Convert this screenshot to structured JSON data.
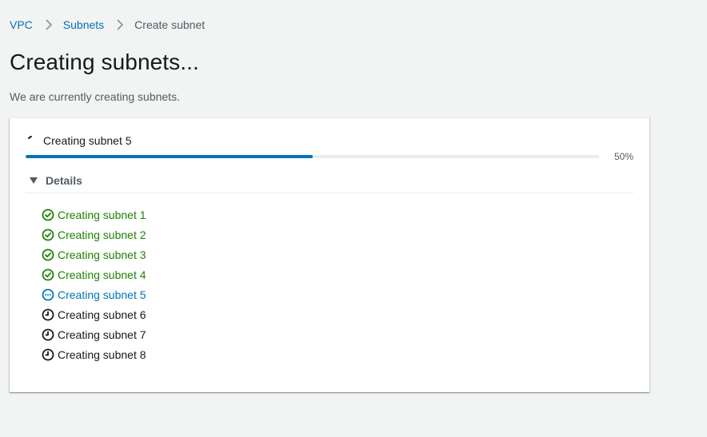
{
  "breadcrumb": {
    "items": [
      {
        "label": "VPC"
      },
      {
        "label": "Subnets"
      },
      {
        "label": "Create subnet"
      }
    ]
  },
  "page": {
    "title": "Creating subnets...",
    "description": "We are currently creating subnets."
  },
  "progress": {
    "label": "Creating subnet 5",
    "percent_text": "50%",
    "value": 0.5
  },
  "details": {
    "label": "Details",
    "expanded": true,
    "steps": [
      {
        "label": "Creating subnet 1",
        "status": "success",
        "icon": "check-circle-icon"
      },
      {
        "label": "Creating subnet 2",
        "status": "success",
        "icon": "check-circle-icon"
      },
      {
        "label": "Creating subnet 3",
        "status": "success",
        "icon": "check-circle-icon"
      },
      {
        "label": "Creating subnet 4",
        "status": "success",
        "icon": "check-circle-icon"
      },
      {
        "label": "Creating subnet 5",
        "status": "in-progress",
        "icon": "ellipsis-circle-icon"
      },
      {
        "label": "Creating subnet 6",
        "status": "pending",
        "icon": "clock-icon"
      },
      {
        "label": "Creating subnet 7",
        "status": "pending",
        "icon": "clock-icon"
      },
      {
        "label": "Creating subnet 8",
        "status": "pending",
        "icon": "clock-icon"
      }
    ]
  },
  "colors": {
    "link": "#0073bb",
    "success": "#1d8102",
    "in_progress": "#0073bb",
    "pending": "#16191f",
    "progress_fill": "#0073bb",
    "progress_track": "#eaeded",
    "background": "#f2f3f3"
  }
}
